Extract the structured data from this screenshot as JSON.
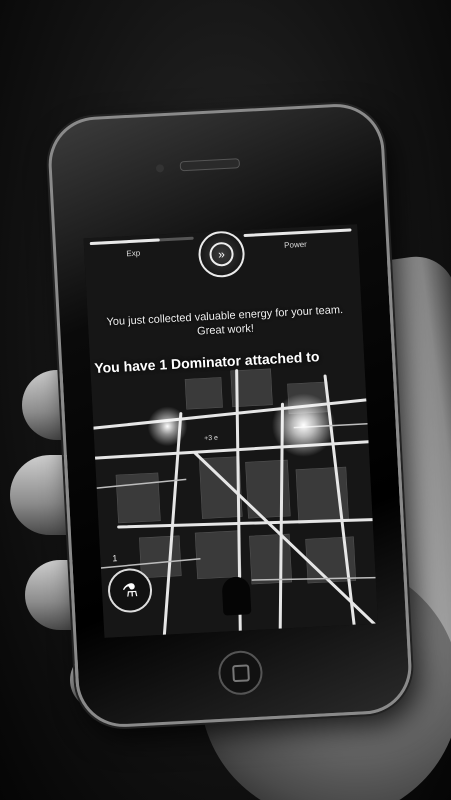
{
  "hud": {
    "exp_label": "Exp",
    "power_label": "Power",
    "exp_fill": 0.67,
    "power_fill": 1.0
  },
  "message": {
    "text": "You just collected valuable energy for your team. Great work!",
    "domination": "You have 1 Dominator attached to"
  },
  "map": {
    "energy_tag": "+3 e",
    "item_count": "1"
  },
  "icons": {
    "emblem": "chevron-down-double-icon",
    "flask": "flask-icon"
  },
  "colors": {
    "screen_bg": "#111111",
    "road": "#e6e6e6",
    "block": "#3a3a3a"
  }
}
